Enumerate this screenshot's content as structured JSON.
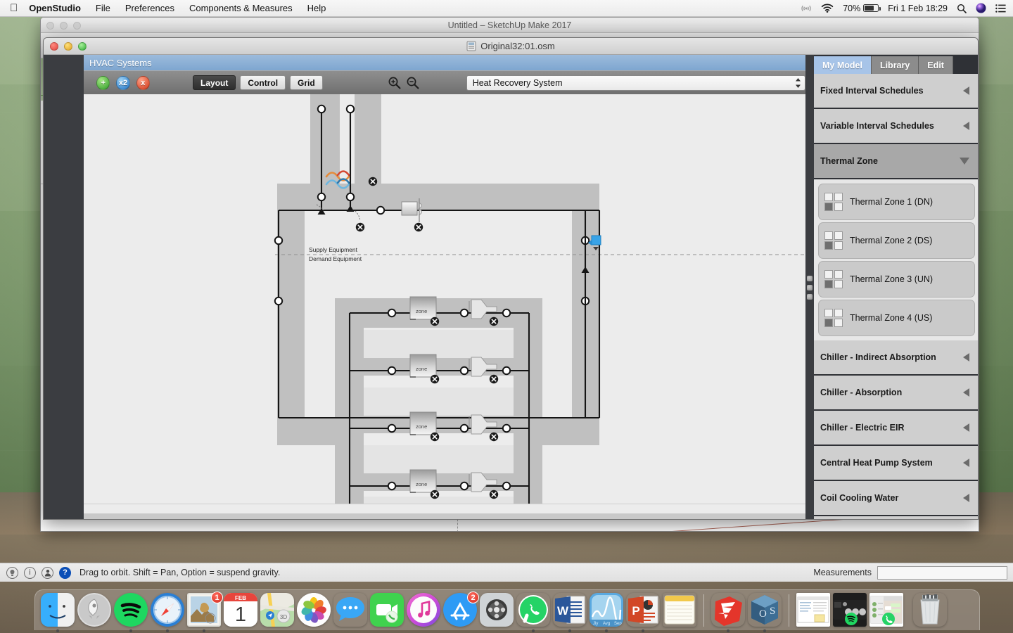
{
  "menubar": {
    "apple_icon": "apple-logo-icon",
    "items": [
      {
        "label": "OpenStudio",
        "bold": true
      },
      {
        "label": "File",
        "bold": false
      },
      {
        "label": "Preferences",
        "bold": false
      },
      {
        "label": "Components & Measures",
        "bold": false
      },
      {
        "label": "Help",
        "bold": false
      }
    ],
    "status": {
      "airplay_icon": "airplay-icon",
      "wifi_icon": "wifi-icon",
      "battery_percent": "70%",
      "battery_icon": "battery-icon",
      "datetime": "Fri 1 Feb  18:29",
      "search_icon": "search-icon",
      "siri_icon": "siri-icon",
      "notification_icon": "notification-center-icon"
    }
  },
  "sketchup_window": {
    "title": "Untitled – SketchUp Make 2017",
    "left_toolbar": [
      {
        "name": "globe-geo-location-tool"
      },
      {
        "name": "advanced-camera-tool"
      },
      {
        "name": "sandbox-tool"
      },
      {
        "name": "outlet-plugin-tool"
      },
      {
        "name": "solid-tools"
      },
      {
        "name": "floorplan-tool"
      },
      {
        "name": "building-maker-tool"
      },
      {
        "name": "box-tool"
      },
      {
        "name": "component-tool"
      },
      {
        "name": "openstudio-refresh-tool",
        "selected": true
      },
      {
        "name": "dynamic-components-tool"
      },
      {
        "name": "settings-gear-tool"
      },
      {
        "name": "scene-export-tool"
      },
      {
        "name": "animation-play-tool"
      },
      {
        "name": "results-chart-tool"
      }
    ]
  },
  "os_window": {
    "title": "Original32:01.osm",
    "doc_icon": "osm-document-icon",
    "traffic_lights": [
      "close-button",
      "minimize-button",
      "zoom-button"
    ],
    "hvac": {
      "header_title": "HVAC Systems",
      "buttons": {
        "add": "+",
        "copy": "x2",
        "delete": "x"
      },
      "tabs": [
        {
          "label": "Layout",
          "active": true
        },
        {
          "label": "Control",
          "active": false
        },
        {
          "label": "Grid",
          "active": false
        }
      ],
      "zoom_in_icon": "zoom-in-icon",
      "zoom_out_icon": "zoom-out-icon",
      "system_select": {
        "value": "Heat Recovery System",
        "options": [
          "Heat Recovery System"
        ]
      }
    },
    "diagram": {
      "supply_label": "Supply Equipment",
      "demand_label": "Demand Equipment",
      "zone_label": "zone",
      "nodes_count": 24
    }
  },
  "library_panel": {
    "tabs": [
      {
        "label": "My Model",
        "active": true
      },
      {
        "label": "Library",
        "active": false
      },
      {
        "label": "Edit",
        "active": false
      }
    ],
    "groups": [
      {
        "label": "Fixed Interval Schedules",
        "expanded": false,
        "items": []
      },
      {
        "label": "Variable Interval Schedules",
        "expanded": false,
        "items": []
      },
      {
        "label": "Thermal Zone",
        "expanded": true,
        "items": [
          {
            "label": "Thermal Zone 1 (DN)"
          },
          {
            "label": "Thermal Zone 2 (DS)"
          },
          {
            "label": "Thermal Zone 3 (UN)"
          },
          {
            "label": "Thermal Zone 4 (US)"
          }
        ]
      },
      {
        "label": "Chiller - Indirect Absorption",
        "expanded": false,
        "items": []
      },
      {
        "label": "Chiller - Absorption",
        "expanded": false,
        "items": []
      },
      {
        "label": "Chiller - Electric EIR",
        "expanded": false,
        "items": []
      },
      {
        "label": "Central Heat Pump System",
        "expanded": false,
        "items": []
      },
      {
        "label": "Coil Cooling Water",
        "expanded": false,
        "items": []
      }
    ]
  },
  "statusbar": {
    "icons": [
      "hint-bulb-icon",
      "info-icon",
      "account-icon",
      "help-icon"
    ],
    "message": "Drag to orbit. Shift = Pan, Option = suspend gravity.",
    "measurements_label": "Measurements",
    "measurements_value": ""
  },
  "dock": {
    "items": [
      {
        "name": "finder",
        "running": true,
        "badge": ""
      },
      {
        "name": "launchpad",
        "running": false,
        "badge": ""
      },
      {
        "name": "spotify",
        "running": true,
        "badge": ""
      },
      {
        "name": "safari",
        "running": true,
        "badge": ""
      },
      {
        "name": "mail",
        "running": true,
        "badge": "1"
      },
      {
        "name": "calendar",
        "running": false,
        "badge": "",
        "month": "FEB",
        "day": "1"
      },
      {
        "name": "maps",
        "running": false,
        "badge": ""
      },
      {
        "name": "photos",
        "running": false,
        "badge": ""
      },
      {
        "name": "messages",
        "running": false,
        "badge": ""
      },
      {
        "name": "facetime",
        "running": false,
        "badge": ""
      },
      {
        "name": "itunes",
        "running": false,
        "badge": ""
      },
      {
        "name": "app-store",
        "running": true,
        "badge": "2"
      },
      {
        "name": "system-preferences",
        "running": false,
        "badge": ""
      },
      {
        "name": "whatsapp",
        "running": true,
        "badge": ""
      },
      {
        "name": "microsoft-word",
        "running": true,
        "badge": ""
      },
      {
        "name": "numbers",
        "running": true,
        "badge": ""
      },
      {
        "name": "microsoft-powerpoint",
        "running": true,
        "badge": ""
      },
      {
        "name": "notes",
        "running": false,
        "badge": ""
      },
      {
        "name": "sketchup",
        "running": true,
        "badge": ""
      },
      {
        "name": "openstudio",
        "running": true,
        "badge": ""
      }
    ],
    "minimized": [
      {
        "name": "minimized-document-window"
      },
      {
        "name": "minimized-spotify-window"
      },
      {
        "name": "minimized-whatsapp-window"
      }
    ],
    "trash": {
      "name": "trash-full"
    }
  },
  "colors": {
    "accent_blue": "#7ea6d0",
    "tab_active_blue": "#a7c4e8",
    "panel_gray": "#cfcfcf",
    "dark_chrome": "#3b3d41",
    "diagram_bg": "#ececec",
    "diagram_band": "#c0c0c0"
  }
}
